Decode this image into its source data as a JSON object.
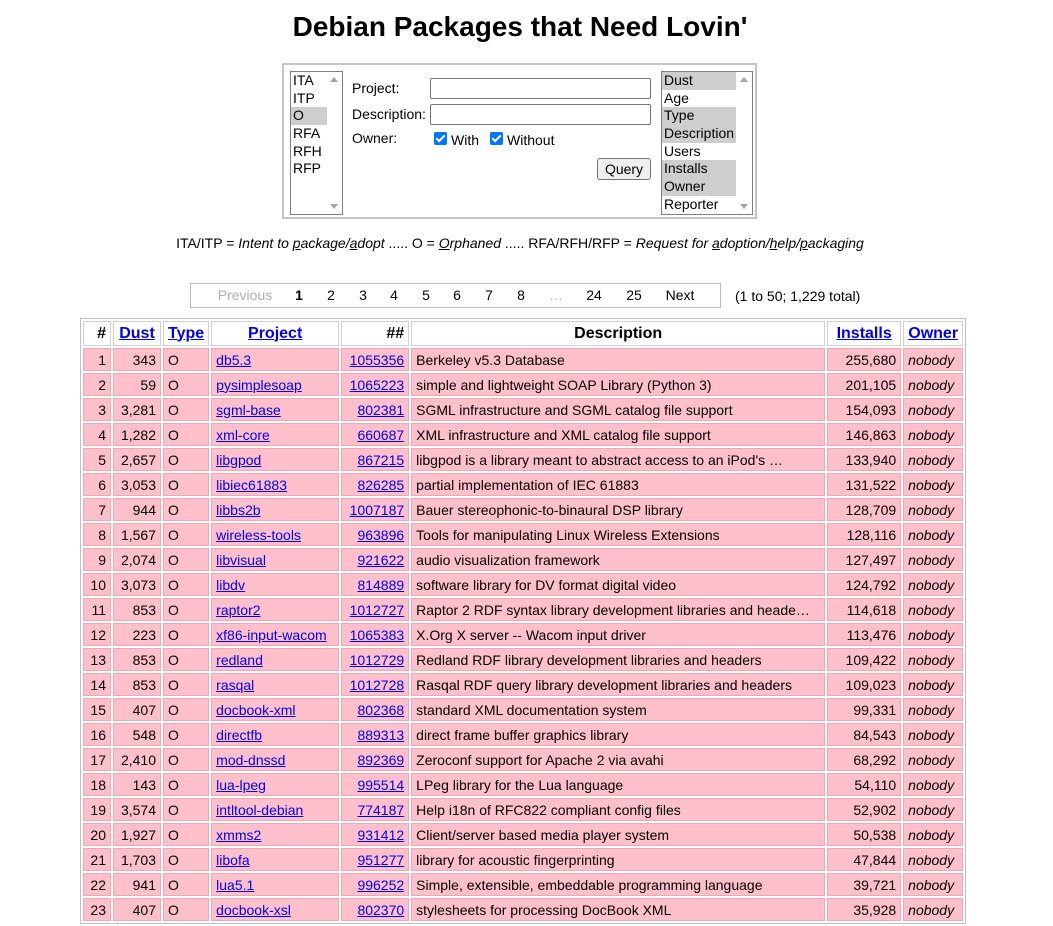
{
  "page": {
    "title": "Debian Packages that Need Lovin'"
  },
  "filter": {
    "status_options": [
      "ITA",
      "ITP",
      "O",
      "RFA",
      "RFH",
      "RFP"
    ],
    "status_selected": [
      "O"
    ],
    "project_label": "Project:",
    "project_value": "",
    "description_label": "Description:",
    "description_value": "",
    "owner_label": "Owner:",
    "owner_with_label": "With",
    "owner_with_checked": true,
    "owner_without_label": "Without",
    "owner_without_checked": true,
    "query_button": "Query",
    "sort_options": [
      "Dust",
      "Age",
      "Type",
      "Description",
      "Users",
      "Installs",
      "Owner",
      "Reporter"
    ],
    "sort_selected": [
      "Dust",
      "Type",
      "Description",
      "Installs",
      "Owner"
    ]
  },
  "legend": {
    "p1": "ITA/ITP = ",
    "i1a": "Intent to ",
    "u1a": "p",
    "i1b": "ackage/",
    "u1b": "a",
    "i1c": "dopt",
    "p2": " ..... O = ",
    "u2": "O",
    "i2": "rphaned",
    "p3": " ..... RFA/RFH/RFP = ",
    "i3a": "Request for ",
    "u3a": "a",
    "i3b": "doption/",
    "u3b": "h",
    "i3c": "elp/",
    "u3c": "p",
    "i3d": "ackaging"
  },
  "pagination": {
    "previous": "Previous",
    "pages": [
      "1",
      "2",
      "3",
      "4",
      "5",
      "6",
      "7",
      "8"
    ],
    "current": "1",
    "ellipsis": "…",
    "tail_pages": [
      "24",
      "25"
    ],
    "next": "Next",
    "total_text": "(1 to 50; 1,229 total)"
  },
  "table": {
    "headers": {
      "num": "#",
      "dust": "Dust",
      "type": "Type",
      "project": "Project",
      "bug": "##",
      "description": "Description",
      "installs": "Installs",
      "owner": "Owner"
    },
    "rows": [
      {
        "num": "1",
        "dust": "343",
        "type": "O",
        "project": "db5.3",
        "bug": "1055356",
        "description": "Berkeley v5.3 Database",
        "installs": "255,680",
        "owner": "nobody"
      },
      {
        "num": "2",
        "dust": "59",
        "type": "O",
        "project": "pysimplesoap",
        "bug": "1065223",
        "description": "simple and lightweight SOAP Library (Python 3)",
        "installs": "201,105",
        "owner": "nobody"
      },
      {
        "num": "3",
        "dust": "3,281",
        "type": "O",
        "project": "sgml-base",
        "bug": "802381",
        "description": "SGML infrastructure and SGML catalog file support",
        "installs": "154,093",
        "owner": "nobody"
      },
      {
        "num": "4",
        "dust": "1,282",
        "type": "O",
        "project": "xml-core",
        "bug": "660687",
        "description": "XML infrastructure and XML catalog file support",
        "installs": "146,863",
        "owner": "nobody"
      },
      {
        "num": "5",
        "dust": "2,657",
        "type": "O",
        "project": "libgpod",
        "bug": "867215",
        "description": "libgpod is a library meant to abstract access to an iPod's …",
        "installs": "133,940",
        "owner": "nobody"
      },
      {
        "num": "6",
        "dust": "3,053",
        "type": "O",
        "project": "libiec61883",
        "bug": "826285",
        "description": "partial implementation of IEC 61883",
        "installs": "131,522",
        "owner": "nobody"
      },
      {
        "num": "7",
        "dust": "944",
        "type": "O",
        "project": "libbs2b",
        "bug": "1007187",
        "description": "Bauer stereophonic-to-binaural DSP library",
        "installs": "128,709",
        "owner": "nobody"
      },
      {
        "num": "8",
        "dust": "1,567",
        "type": "O",
        "project": "wireless-tools",
        "bug": "963896",
        "description": "Tools for manipulating Linux Wireless Extensions",
        "installs": "128,116",
        "owner": "nobody"
      },
      {
        "num": "9",
        "dust": "2,074",
        "type": "O",
        "project": "libvisual",
        "bug": "921622",
        "description": "audio visualization framework",
        "installs": "127,497",
        "owner": "nobody"
      },
      {
        "num": "10",
        "dust": "3,073",
        "type": "O",
        "project": "libdv",
        "bug": "814889",
        "description": "software library for DV format digital video",
        "installs": "124,792",
        "owner": "nobody"
      },
      {
        "num": "11",
        "dust": "853",
        "type": "O",
        "project": "raptor2",
        "bug": "1012727",
        "description": "Raptor 2 RDF syntax library development libraries and heade…",
        "installs": "114,618",
        "owner": "nobody"
      },
      {
        "num": "12",
        "dust": "223",
        "type": "O",
        "project": "xf86-input-wacom",
        "bug": "1065383",
        "description": "X.Org X server -- Wacom input driver",
        "installs": "113,476",
        "owner": "nobody"
      },
      {
        "num": "13",
        "dust": "853",
        "type": "O",
        "project": "redland",
        "bug": "1012729",
        "description": "Redland RDF library development libraries and headers",
        "installs": "109,422",
        "owner": "nobody"
      },
      {
        "num": "14",
        "dust": "853",
        "type": "O",
        "project": "rasqal",
        "bug": "1012728",
        "description": "Rasqal RDF query library development libraries and headers",
        "installs": "109,023",
        "owner": "nobody"
      },
      {
        "num": "15",
        "dust": "407",
        "type": "O",
        "project": "docbook-xml",
        "bug": "802368",
        "description": "standard XML documentation system",
        "installs": "99,331",
        "owner": "nobody"
      },
      {
        "num": "16",
        "dust": "548",
        "type": "O",
        "project": "directfb",
        "bug": "889313",
        "description": "direct frame buffer graphics library",
        "installs": "84,543",
        "owner": "nobody"
      },
      {
        "num": "17",
        "dust": "2,410",
        "type": "O",
        "project": "mod-dnssd",
        "bug": "892369",
        "description": "Zeroconf support for Apache 2 via avahi",
        "installs": "68,292",
        "owner": "nobody"
      },
      {
        "num": "18",
        "dust": "143",
        "type": "O",
        "project": "lua-lpeg",
        "bug": "995514",
        "description": "LPeg library for the Lua language",
        "installs": "54,110",
        "owner": "nobody"
      },
      {
        "num": "19",
        "dust": "3,574",
        "type": "O",
        "project": "intltool-debian",
        "bug": "774187",
        "description": "Help i18n of RFC822 compliant config files",
        "installs": "52,902",
        "owner": "nobody"
      },
      {
        "num": "20",
        "dust": "1,927",
        "type": "O",
        "project": "xmms2",
        "bug": "931412",
        "description": "Client/server based media player system",
        "installs": "50,538",
        "owner": "nobody"
      },
      {
        "num": "21",
        "dust": "1,703",
        "type": "O",
        "project": "libofa",
        "bug": "951277",
        "description": "library for acoustic fingerprinting",
        "installs": "47,844",
        "owner": "nobody"
      },
      {
        "num": "22",
        "dust": "941",
        "type": "O",
        "project": "lua5.1",
        "bug": "996252",
        "description": "Simple, extensible, embeddable programming language",
        "installs": "39,721",
        "owner": "nobody"
      },
      {
        "num": "23",
        "dust": "407",
        "type": "O",
        "project": "docbook-xsl",
        "bug": "802370",
        "description": "stylesheets for processing DocBook XML",
        "installs": "35,928",
        "owner": "nobody"
      }
    ]
  }
}
